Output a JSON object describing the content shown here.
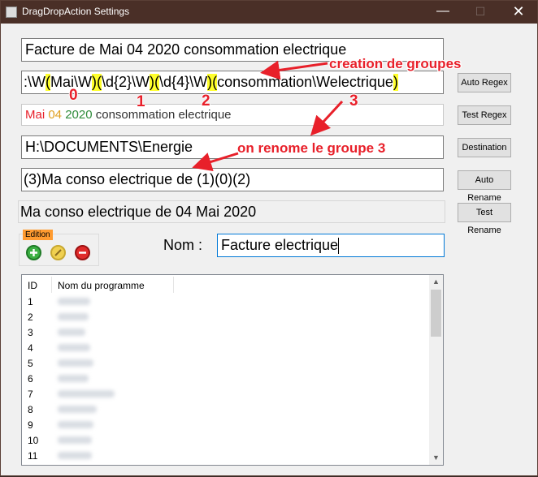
{
  "window": {
    "title": "DragDropAction Settings",
    "minimize": "—",
    "maximize": "☐",
    "close": "✕"
  },
  "filename": "Facture de Mai 04 2020 consommation electrique",
  "regex": {
    "parts": [
      ":\\W",
      "(",
      "Mai\\W",
      ")",
      "(",
      "\\d{2}\\W",
      ")",
      "(",
      "\\d{4}\\W",
      ")",
      "(",
      "consommation\\Welectrique",
      ")"
    ]
  },
  "test_result": {
    "g0": "Mai",
    "g1": "04",
    "g2": "2020",
    "g3": "consommation electrique",
    "colors": {
      "g0": "#e8202a",
      "g1": "#e0a020",
      "g2": "#2e8b3a",
      "g3": "#333333"
    }
  },
  "destination": "H:\\DOCUMENTS\\Energie",
  "rename_pattern": "(3)Ma conso electrique de (1)(0)(2)",
  "rename_result": "Ma conso electrique de 04 Mai 2020",
  "buttons": {
    "auto_regex": "Auto Regex",
    "test_regex": "Test Regex",
    "destination": "Destination",
    "auto_rename": "Auto Rename",
    "test_rename": "Test Rename"
  },
  "annotations": {
    "creation_groupes": "creation de groupes",
    "renomme_groupe": "on renome le groupe 3",
    "n0": "0",
    "n1": "1",
    "n2": "2",
    "n3": "3"
  },
  "edition": {
    "label": "Edition",
    "icons": [
      "add-icon",
      "edit-icon",
      "remove-icon"
    ]
  },
  "nom": {
    "label": "Nom :",
    "value": "Facture electrique"
  },
  "list": {
    "headers": {
      "id": "ID",
      "name": "Nom du programme"
    },
    "rows": [
      "1",
      "2",
      "3",
      "4",
      "5",
      "6",
      "7",
      "8",
      "9",
      "10",
      "11"
    ]
  },
  "colors": {
    "highlight": "#ffff2a",
    "annotation": "#e8202a",
    "titlebar": "#4a2f27"
  }
}
